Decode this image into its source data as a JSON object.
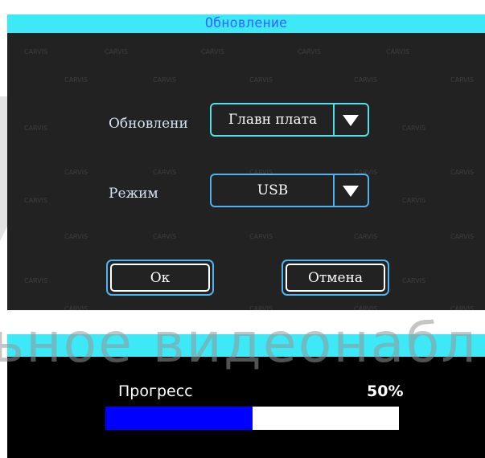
{
  "dialog": {
    "title": "Обновление",
    "update_label": "Обновлени",
    "update_value": "Главн плата",
    "mode_label": "Режим",
    "mode_value": "USB",
    "ok_label": "Ок",
    "cancel_label": "Отмена"
  },
  "progress": {
    "label": "Прогресс",
    "percent_text": "50%",
    "value": 0.5
  },
  "watermark": {
    "brand": "CARVIS",
    "overlay_text": "ьное видеонабл"
  },
  "colors": {
    "titlebar": "#3ee9f7",
    "title_text": "#3566ff",
    "dialog_bg": "#222222",
    "control_border": "#4fb2f0",
    "progress_fill": "#0000ff"
  },
  "icons": {
    "dropdown": "chevron-down-icon"
  }
}
